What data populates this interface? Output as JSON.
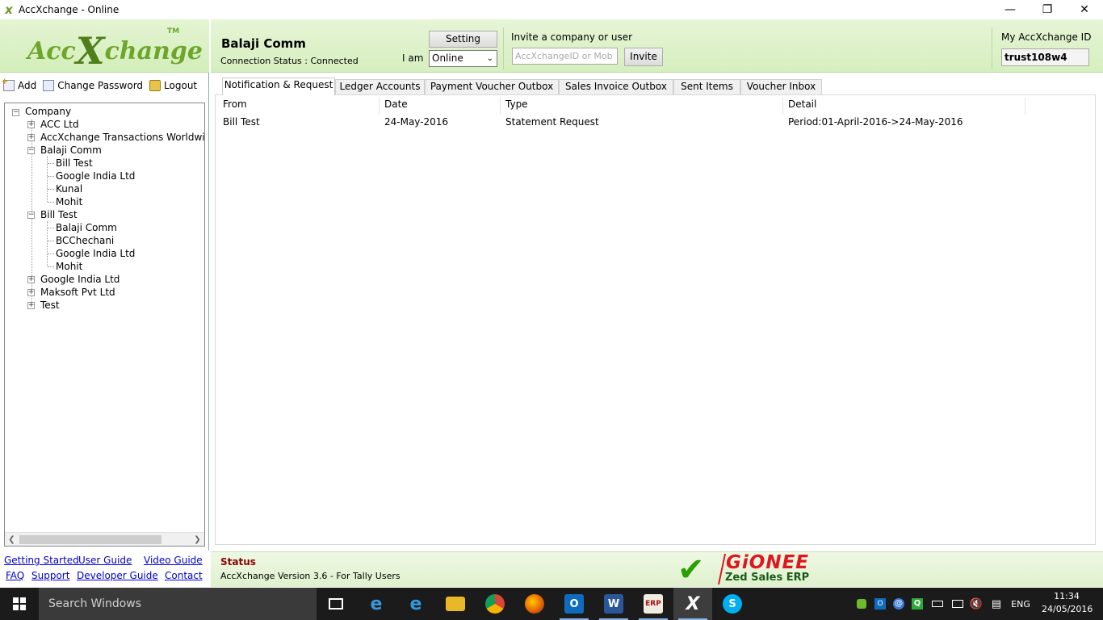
{
  "window": {
    "title": "AccXchange - Online",
    "minimize": "—",
    "restore": "❐",
    "close": "✕"
  },
  "logo": {
    "text_a": "Acc",
    "text_x": "X",
    "text_b": "change",
    "tm": "TM"
  },
  "left_toolbar": {
    "add": "Add",
    "change_password": "Change Password",
    "logout": "Logout"
  },
  "tree": {
    "root": "Company",
    "nodes": [
      {
        "label": "ACC Ltd"
      },
      {
        "label": "AccXchange Transactions Worldwid"
      },
      {
        "label": "Balaji Comm",
        "children": [
          "Bill Test",
          "Google India Ltd",
          "Kunal",
          "Mohit"
        ]
      },
      {
        "label": "Bill Test",
        "children": [
          "Balaji Comm",
          "BCChechani",
          "Google India Ltd",
          "Mohit"
        ]
      },
      {
        "label": "Google India Ltd"
      },
      {
        "label": "Maksoft Pvt Ltd"
      },
      {
        "label": "Test"
      }
    ]
  },
  "links": {
    "getting_started": "Getting Started",
    "user_guide": "User Guide",
    "video_guide": "Video Guide",
    "faq": "FAQ",
    "support": "Support",
    "developer_guide": "Developer Guide",
    "contact": "Contact"
  },
  "header": {
    "company": "Balaji Comm",
    "connection_status": "Connection Status : Connected",
    "setting_button": "Setting",
    "iam_label": "I am",
    "iam_value": "Online",
    "invite_label": "Invite a company or user",
    "invite_placeholder": "AccXchangeID or Mob",
    "invite_button": "Invite",
    "myid_label": "My AccXchange ID",
    "myid_value": "trust108w4"
  },
  "tabs": [
    {
      "label": "Notification & Request",
      "active": true
    },
    {
      "label": "Ledger Accounts",
      "active": false
    },
    {
      "label": "Payment Voucher Outbox",
      "active": false
    },
    {
      "label": "Sales Invoice Outbox",
      "active": false
    },
    {
      "label": "Sent Items",
      "active": false
    },
    {
      "label": "Voucher Inbox",
      "active": false
    }
  ],
  "table": {
    "columns": [
      "From",
      "Date",
      "Type",
      "Detail"
    ],
    "rows": [
      [
        "Bill Test",
        "24-May-2016",
        "Statement Request",
        "Period:01-April-2016->24-May-2016"
      ]
    ]
  },
  "status": {
    "title": "Status",
    "text": "AccXchange Version 3.6 - For Tally Users",
    "brand": "GiONEE",
    "brand_sub": "Zed Sales ERP"
  },
  "taskbar": {
    "search_placeholder": "Search Windows",
    "apps": [
      "task-view",
      "edge",
      "internet-explorer",
      "file-explorer",
      "chrome",
      "firefox",
      "outlook",
      "word",
      "tally",
      "accxchange",
      "skype"
    ],
    "language": "ENG",
    "time": "11:34",
    "date": "24/05/2016"
  },
  "colors": {
    "accent_green": "#6ea62b",
    "header_green": "#d6efbf",
    "status_red": "#8b0000",
    "link_blue": "#0000cc",
    "brand_red": "#e0161e"
  }
}
